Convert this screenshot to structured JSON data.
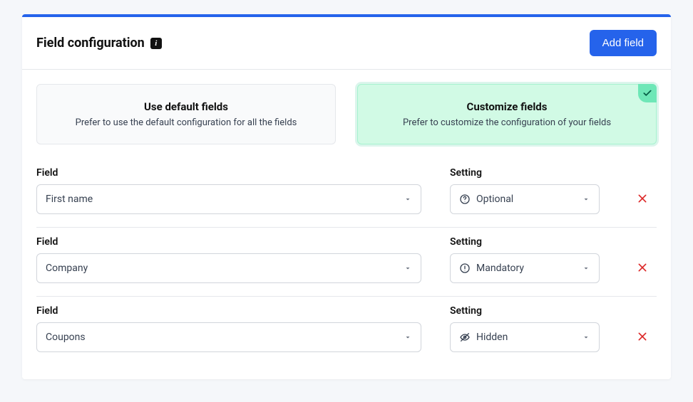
{
  "header": {
    "title": "Field configuration",
    "add_button": "Add field"
  },
  "modes": {
    "default": {
      "title": "Use default fields",
      "desc": "Prefer to use the default configuration for all the fields",
      "selected": false
    },
    "customize": {
      "title": "Customize fields",
      "desc": "Prefer to customize the configuration of your fields",
      "selected": true
    }
  },
  "labels": {
    "field": "Field",
    "setting": "Setting"
  },
  "settings": {
    "optional": "Optional",
    "mandatory": "Mandatory",
    "hidden": "Hidden"
  },
  "rows": [
    {
      "field": "First name",
      "setting_key": "optional"
    },
    {
      "field": "Company",
      "setting_key": "mandatory"
    },
    {
      "field": "Coupons",
      "setting_key": "hidden"
    }
  ]
}
